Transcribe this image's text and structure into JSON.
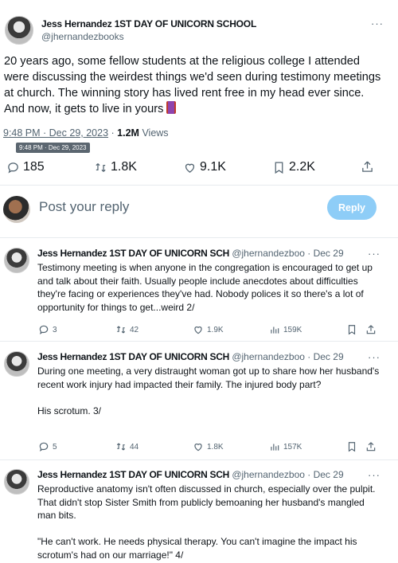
{
  "main": {
    "author_name": "Jess Hernandez 1ST DAY OF UNICORN SCHOOL",
    "handle": "@jhernandezbooks",
    "text": "20 years ago, some fellow students at the religious college I attended were discussing the weirdest things we'd seen during testimony meetings at church. The winning story has lived rent free in my head ever since. And now, it gets to live in yours",
    "time": "9:48 PM · Dec 29, 2023",
    "views_count": "1.2M",
    "views_label": "Views",
    "tooltip": "9:48 PM · Dec 29, 2023",
    "stats": {
      "replies": "185",
      "reposts": "1.8K",
      "likes": "9.1K",
      "bookmarks": "2.2K"
    }
  },
  "reply_box": {
    "placeholder": "Post your reply",
    "button": "Reply"
  },
  "thread": [
    {
      "name": "Jess Hernandez 1ST DAY OF UNICORN SCH",
      "handle": "@jhernandezboo",
      "date": "· Dec 29",
      "text": "Testimony meeting is when anyone in the congregation is encouraged to get up and talk about their faith. Usually people include anecdotes about difficulties they're facing or experiences they've had. Nobody polices it so there's a lot of opportunity for things to get...weird 2/",
      "stats": {
        "replies": "3",
        "reposts": "42",
        "likes": "1.9K",
        "views": "159K"
      }
    },
    {
      "name": "Jess Hernandez 1ST DAY OF UNICORN SCH",
      "handle": "@jhernandezboo",
      "date": "· Dec 29",
      "text": "During one meeting, a very distraught woman got up to share how her husband's recent work injury had impacted their family. The injured body part?\n\nHis scrotum. 3/",
      "stats": {
        "replies": "5",
        "reposts": "44",
        "likes": "1.8K",
        "views": "157K"
      }
    },
    {
      "name": "Jess Hernandez 1ST DAY OF UNICORN SCH",
      "handle": "@jhernandezboo",
      "date": "· Dec 29",
      "text": "Reproductive anatomy isn't often discussed in church, especially over the pulpit. That didn't stop Sister Smith from publicly bemoaning her husband's mangled man bits.\n\n\"He can't work. He needs physical therapy. You can't imagine the impact his scrotum's had on our marriage!\" 4/"
    }
  ],
  "more_symbol": "···",
  "icons": [
    "reply-icon",
    "repost-icon",
    "like-icon",
    "views-icon",
    "bookmark-icon",
    "share-icon",
    "thread-emoji-icon"
  ]
}
